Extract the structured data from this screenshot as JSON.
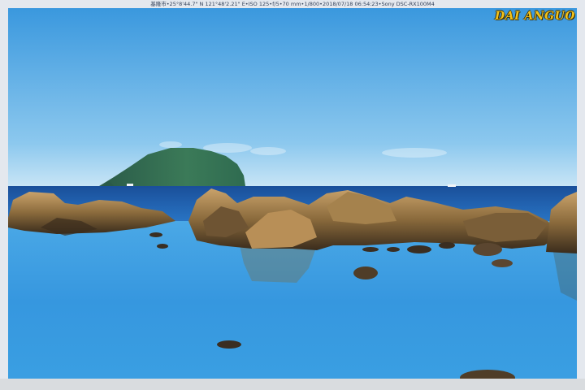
{
  "photo": {
    "exif_caption": "基隆市•25°8'44.7\" N 121°48'2.21\" E•ISO 125•f/5•70 mm•1/800•2018/07/18 06:54:23•Sony DSC-RX100M4",
    "watermark": "DAI ANGUO",
    "colors": {
      "sky_top": "#3d9be0",
      "sky_horizon": "#bfe0f4",
      "sea": "#1d5fb0",
      "lagoon": "#3aa0e6",
      "island": "#2f6b4f",
      "rock": "#8a6a3c"
    }
  }
}
